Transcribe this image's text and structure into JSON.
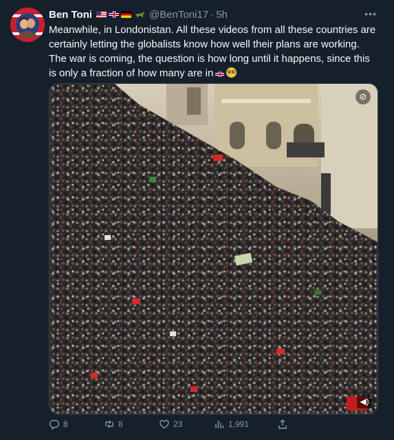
{
  "author": {
    "name": "Ben Toni",
    "handle": "@BenToni17",
    "time": "· 5h",
    "icons": [
      "us-flag-icon",
      "uk-flag-icon",
      "germany-flag-icon",
      "animal-icon"
    ]
  },
  "tweet": {
    "text": "Meanwhile, in Londonistan. All these videos from all these countries are certainly letting the globalists know how well their plans are working. The war is coming, the question is how long until it happens, since this is only a fraction of how many are in",
    "trailing_emojis": [
      "uk-flag-icon",
      "flushed-face-icon"
    ]
  },
  "media": {
    "type": "video",
    "description_icons": [
      "gif-badge-icon",
      "volume-icon"
    ],
    "colors": {
      "crowd": "#2e2a2b",
      "building": "#c9bfa8",
      "flag_red": "#d72b2b"
    }
  },
  "actions": {
    "replies": "8",
    "reposts": "8",
    "likes": "23",
    "views": "1,991"
  },
  "theme": {
    "background": "#15202b",
    "text": "#f7f9f9",
    "muted": "#8b98a5",
    "border": "#38444d"
  }
}
